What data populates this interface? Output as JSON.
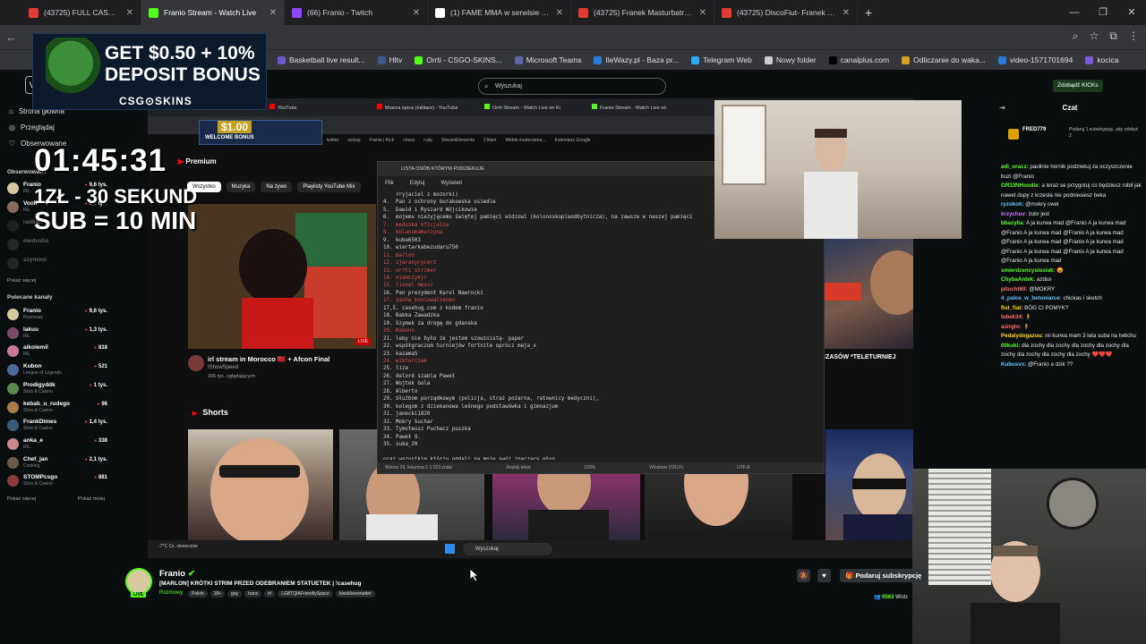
{
  "browser": {
    "tabs": [
      {
        "label": "(43725) FULL CASE BREAK UCC",
        "color": "#e53935",
        "active": false
      },
      {
        "label": "Franio Stream - Watch Live",
        "color": "#53fc18",
        "active": true
      },
      {
        "label": "(66) Franio - Twitch",
        "color": "#9146ff",
        "active": false
      },
      {
        "label": "(1) FAME MMA w serwisie X: „B",
        "color": "#ffffff",
        "active": false
      },
      {
        "label": "(43725) Franek Masturbatra - D",
        "color": "#e53935",
        "active": false
      },
      {
        "label": "(43725) DiscoFiut- Franek Praw",
        "color": "#e53935",
        "active": false
      }
    ],
    "new_tab": "+",
    "bookmarks": [
      {
        "label": "Basketball live result...",
        "color": "#6a5acd"
      },
      {
        "label": "Hltv",
        "color": "#3a5a8a"
      },
      {
        "label": "Orrti - CSGO-SKINS...",
        "color": "#53fc18"
      },
      {
        "label": "Microsoft Teams",
        "color": "#6264a7"
      },
      {
        "label": "IleWazy.pl - Baza pr...",
        "color": "#2a7ad8"
      },
      {
        "label": "Telegram Web",
        "color": "#2aabee"
      },
      {
        "label": "Nowy folder",
        "color": "#cccccc"
      },
      {
        "label": "canalplus.com",
        "color": "#000000"
      },
      {
        "label": "Odliczanie do waka...",
        "color": "#d8a020"
      },
      {
        "label": "video-1571701694",
        "color": "#2a7ad8"
      },
      {
        "label": "kocica",
        "color": "#7a5ad8"
      }
    ]
  },
  "kick": {
    "logo": "VJ",
    "search_placeholder": "Wyszukaj",
    "subscribe_cta": "Zdobądź KICKs",
    "nav": [
      {
        "label": "Strona główna",
        "icon": "home-icon"
      },
      {
        "label": "Przeglądaj",
        "icon": "compass-icon"
      },
      {
        "label": "Obserwowane",
        "icon": "heart-icon"
      }
    ],
    "followed_title": "Obserwowane",
    "followed": [
      {
        "name": "Franio",
        "category": "IRL",
        "viewers": "9,6 tys.",
        "color": "#d8c8a0",
        "dim": false
      },
      {
        "name": "Vooliation",
        "category": "IRL",
        "viewers": "9,6 tys.",
        "color": "#8a6a5a",
        "dim": false
      },
      {
        "name": "radkan",
        "category": "",
        "viewers": "",
        "color": "#444444",
        "dim": true
      },
      {
        "name": "meduska",
        "category": "",
        "viewers": "",
        "color": "#555555",
        "dim": true
      },
      {
        "name": "szymooi",
        "category": "",
        "viewers": "",
        "color": "#555555",
        "dim": true
      }
    ],
    "followed_more": "Pokaż więcej",
    "recommended_title": "Polecane kanały",
    "recommended": [
      {
        "name": "Franio",
        "category": "Rozmowy",
        "viewers": "9,6 tys.",
        "color": "#d8c8a0"
      },
      {
        "name": "lakuu",
        "category": "IRL",
        "viewers": "1,3 tys.",
        "color": "#7a4a6a"
      },
      {
        "name": "aikoiemil",
        "category": "IRL",
        "viewers": "818",
        "color": "#c87a9a"
      },
      {
        "name": "Kubon",
        "category": "League of Legends",
        "viewers": "521",
        "color": "#4a6a9a"
      },
      {
        "name": "Prodigyddk",
        "category": "Slots & Casino",
        "viewers": "1 tys.",
        "color": "#5a8a4a"
      },
      {
        "name": "kebab_u_rudego",
        "category": "Slots & Casino",
        "viewers": "96",
        "color": "#a87a4a"
      },
      {
        "name": "FrankDimes",
        "category": "Slots & Casino",
        "viewers": "1,4 tys.",
        "color": "#3a5a7a"
      },
      {
        "name": "anka_e",
        "category": "IRL",
        "viewers": "338",
        "color": "#c88a8a"
      },
      {
        "name": "Chef_jan",
        "category": "Cooking",
        "viewers": "2,1 tys.",
        "color": "#6a5a4a"
      },
      {
        "name": "STOMPcsgo",
        "category": "Slots & Casino",
        "viewers": "881",
        "color": "#8a3a3a"
      }
    ],
    "rec_more": "Pokaż więcej",
    "rec_less": "Pokaż mniej"
  },
  "overlay": {
    "ad_line1": "GET $0.50 + 10%",
    "ad_line2": "DEPOSIT BONUS",
    "ad_brand": "CSG⊙SKINS",
    "timer": "01:45:31",
    "rule1": "1ZŁ - 30 SEKUND",
    "rule2": "SUB = 10 MIN",
    "inner_ad": "$1.00",
    "inner_ad_sub": "WELCOME BONUS"
  },
  "inner": {
    "tabs": [
      "YouTube",
      "Musica epica (militare) - YouTube",
      "Orrti Stream - Watch Live on Ki",
      "Franio Stream - Watch Live on"
    ],
    "bookmarks": [
      "twitter",
      "wykop",
      "Franio | Kick",
      "chess",
      "rudy",
      "StreamElements",
      "Chłam",
      "Widok moderatora...",
      "Kalendarz Google"
    ],
    "yt_brand": "Premium",
    "chips": [
      "Wszystko",
      "Muzyka",
      "Na żywo",
      "Playlisty YouTube Mix"
    ],
    "video_title": "irl stream in Morocco 🇲🇦 + Afcon Final",
    "video_channel": "IShowSpeed",
    "video_views": "306 tys. oglądających",
    "shorts": "Shorts",
    "right_title": "CZASÓW *TELETURNIEJ",
    "taskbar_search": "Wyszukaj",
    "weather": "-7°C Cz. słonecznie"
  },
  "notepad": {
    "title": "LISTA OSÓB KTÓRYM PODZIEKUJE",
    "menu": [
      "Plik",
      "Edytuj",
      "Wyświetl"
    ],
    "lines": [
      {
        "t": "    rryjaciel z mozorki)",
        "r": false
      },
      {
        "t": "4.  Pan z ochrony burakowska osiedle",
        "r": false
      },
      {
        "t": "5.  Dawid i Ryszard Wójcikowie",
        "r": false
      },
      {
        "t": "6.  mojemu nieżyjącemu świętej pamięci widzowi (kolonoskopiaodbytnicza), na zawsze w naszej pamięci",
        "r": false
      },
      {
        "t": "7.  meduska oficjalna",
        "r": true
      },
      {
        "t": "8.  kolanomamurzyna",
        "r": true
      },
      {
        "t": "9.  kuba6503",
        "r": false
      },
      {
        "t": "10. wiertarkabezudaru750",
        "r": false
      },
      {
        "t": "11. marlon",
        "r": true
      },
      {
        "t": "12. zjaranyrycerz",
        "r": true
      },
      {
        "t": "13. orrti strimer",
        "r": true
      },
      {
        "t": "14. niemczykjr",
        "r": true
      },
      {
        "t": "15. lionel messi",
        "r": true
      },
      {
        "t": "16. Pan prezydent Karol Nawrocki",
        "r": false
      },
      {
        "t": "17. sasha_koniowalienko",
        "r": true
      },
      {
        "t": "17,5. casehug.com z kodem franio",
        "r": false
      },
      {
        "t": "18. Babka Zawadzka",
        "r": false
      },
      {
        "t": "19. Szymek za drogę do gdanska",
        "r": false
      },
      {
        "t": "20. Kakens",
        "r": true
      },
      {
        "t": "21. leby nie było że jestem szowinistą- paper",
        "r": false
      },
      {
        "t": "22. współgraczom turniejów fortnite oprócz maja_x",
        "r": false
      },
      {
        "t": "23. kazama5",
        "r": false
      },
      {
        "t": "24. wiktorczak",
        "r": true
      },
      {
        "t": "25. liza",
        "r": false
      },
      {
        "t": "26. delord szabla Paweł",
        "r": false
      },
      {
        "t": "27. Wojtek Gola",
        "r": false
      },
      {
        "t": "28. Alberto",
        "r": false
      },
      {
        "t": "29. Służbom porządkowym (policja, straż pożarna, ratownicy medyczni),",
        "r": false
      },
      {
        "t": "30. kolegom z dziekanowa leśnego podstawówka i gimnazjum",
        "r": false
      },
      {
        "t": "31. janecki1820",
        "r": false
      },
      {
        "t": "32. Mokry Suchar",
        "r": false
      },
      {
        "t": "33. Tymoteusz Puchacz puszka",
        "r": false
      },
      {
        "t": "34. Paweł O.",
        "r": false
      },
      {
        "t": "35. suka_20",
        "r": false
      },
      {
        "t": "",
        "r": false
      },
      {
        "t": "oraz wszystkim którzy oddali na mnie swój znaczący głos",
        "r": false
      }
    ],
    "status": [
      "Wiersz 39, kolumna 1  1 023 znaki",
      "Zwykły tekst",
      "100%",
      "Windows (CRLF)",
      "UTF-8"
    ]
  },
  "chat": {
    "title": "Czat",
    "banner_user": "FRED779",
    "banner_text": "Podaruj 1 subskrypcję, aby zdobyć 2.",
    "messages": [
      {
        "user": "adi_oracz:",
        "color": "#53fc18",
        "text": "paulinie hornik podziekuj za oczyszczenie buzi @Franio"
      },
      {
        "user": "GR33NHoodie:",
        "color": "#53fc18",
        "text": "a teraz se przygotuj co będziesz robił jak nawet dupy z krzesła nie podniesiesz beka"
      },
      {
        "user": "ryzokok:",
        "color": "#5ac8fa",
        "text": "@mokry cwel"
      },
      {
        "user": "krzychuv:",
        "color": "#c878ff",
        "text": "żubr jest"
      },
      {
        "user": "bbazylia:",
        "color": "#53fc18",
        "text": "A ja kurwa mad @Franio A ja kurwa mad @Franio A ja kurwa mad @Franio A ja kurwa mad @Franio A ja kurwa mad @Franio A ja kurwa mad @Franio A ja kurwa mad @Franio A ja kurwa mad @Franio A ja kurwa mad"
      },
      {
        "user": "smierdzencysiusiak:",
        "color": "#53fc18",
        "text": "😡"
      },
      {
        "user": "ChybaAntek:",
        "color": "#53fc18",
        "text": "azdus"
      },
      {
        "user": "pitucht69:",
        "color": "#ff6b6b",
        "text": "@MOKRY"
      },
      {
        "user": "4_palce_w_betoniarce:",
        "color": "#5ac8fa",
        "text": "chickas i sketch"
      },
      {
        "user": "fiut_fiat:",
        "color": "#ffd60a",
        "text": "BÓG CI POMYK?"
      },
      {
        "user": "lubek34:",
        "color": "#ff6b6b",
        "text": "🧍"
      },
      {
        "user": "asirgto:",
        "color": "#ff6b6b",
        "text": "🧍"
      },
      {
        "user": "Pedalydogazuu:",
        "color": "#ffd60a",
        "text": "mi kurwa mam 3 lata suba na twitchu"
      },
      {
        "user": "00kuki:",
        "color": "#53fc18",
        "text": "dla zochy dla zochy dla zochy dla zochy dla zochy dla zochy dla zochy dla zochy ❤️❤️❤️"
      },
      {
        "user": "Kubusvx:",
        "color": "#5ac8fa",
        "text": "@Franio a dzik ??"
      }
    ]
  },
  "channel": {
    "name": "Franio",
    "live": "LIVE",
    "title": "[MARLON] KRÓTKI STRIM PRZED ODEBRANIEM STATUETEK | !casehug",
    "category": "Rozmowy",
    "tags": [
      "Polish",
      "18+",
      "gay",
      "trans",
      "irl",
      "LGBTQIAFriendlySpace",
      "blacklivesmatter"
    ],
    "subscribe": "Podaruj subskrypcję",
    "viewers": "9563",
    "viewers_suffix": "Widz"
  }
}
